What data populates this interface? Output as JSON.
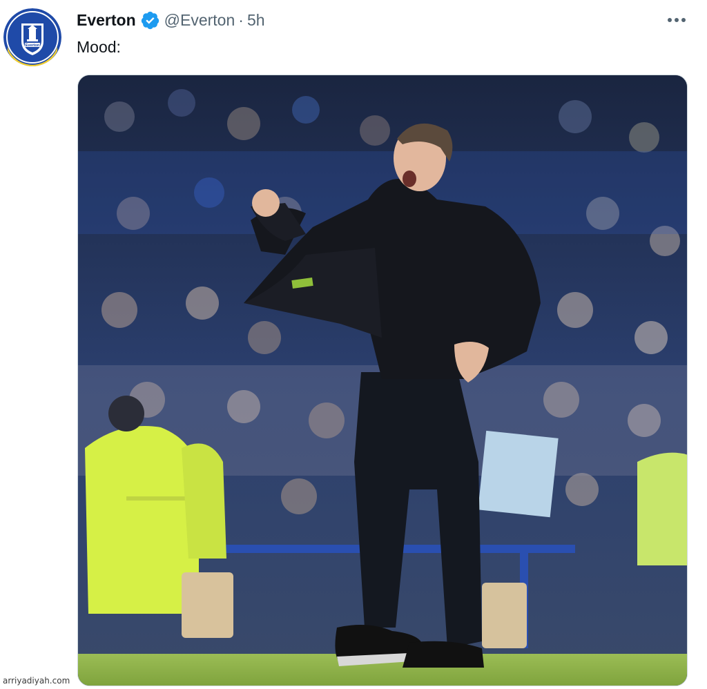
{
  "tweet": {
    "author_name": "Everton",
    "handle": "@Everton",
    "separator": "·",
    "time": "5h",
    "text": "Mood:",
    "verified": true,
    "more_icon": "ellipsis-horizontal-icon"
  },
  "avatar": {
    "icon": "everton-crest-icon",
    "crest_text": "Everton"
  },
  "media": {
    "description_icon": "photo-icon"
  },
  "watermark": "arriyadiyah.com",
  "colors": {
    "verified_blue": "#1d9bf0",
    "secondary_text": "#536471",
    "everton_blue": "#1f4aa8",
    "hi_vis": "#d6f046",
    "pitch_green": "#8fb34a"
  }
}
